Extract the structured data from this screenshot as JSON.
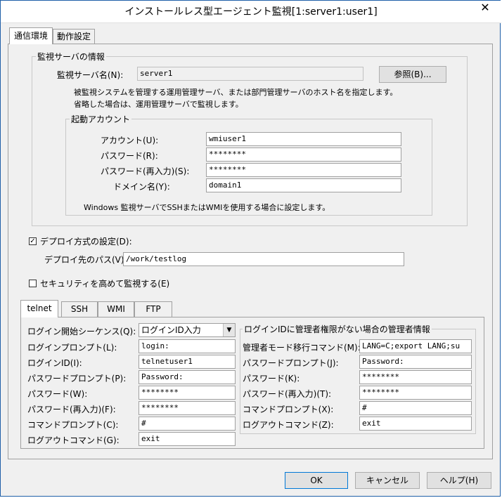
{
  "window": {
    "title": "インストールレス型エージェント監視[1:server1:user1]",
    "close_glyph": "✕"
  },
  "tabs": [
    "通信環境",
    "動作設定"
  ],
  "monitor_server": {
    "group_label": "監視サーバの情報",
    "name_label": "監視サーバ名(N):",
    "name_value": "server1",
    "browse_label": "参照(B)...",
    "desc1": "被監視システムを管理する運用管理サーバ、または部門管理サーバのホスト名を指定します。",
    "desc2": "省略した場合は、運用管理サーバで監視します。"
  },
  "startup_account": {
    "group_label": "起動アカウント",
    "account_label": "アカウント(U):",
    "account_value": "wmiuser1",
    "password_label": "パスワード(R):",
    "password_value": "********",
    "password2_label": "パスワード(再入力)(S):",
    "password2_value": "********",
    "domain_label": "ドメイン名(Y):",
    "domain_value": "domain1",
    "note": "Windows 監視サーバでSSHまたはWMIを使用する場合に設定します。"
  },
  "deploy": {
    "checked_glyph": "✓",
    "label": "デプロイ方式の設定(D):",
    "path_label": "デプロイ先のパス(V):",
    "path_value": "/work/testlog"
  },
  "security": {
    "label": "セキュリティを高めて監視する(E)"
  },
  "proto_tabs": [
    "telnet",
    "SSH",
    "WMI",
    "FTP"
  ],
  "telnet": {
    "seq_label": "ログイン開始シーケンス(Q):",
    "seq_value": "ログインID入力",
    "arrow_glyph": "▼",
    "login_prompt_label": "ログインプロンプト(L):",
    "login_prompt_value": "login:",
    "login_id_label": "ログインID(I):",
    "login_id_value": "telnetuser1",
    "pw_prompt_label": "パスワードプロンプト(P):",
    "pw_prompt_value": "Password:",
    "pw_label": "パスワード(W):",
    "pw_value": "********",
    "pw2_label": "パスワード(再入力)(F):",
    "pw2_value": "********",
    "cmd_prompt_label": "コマンドプロンプト(C):",
    "cmd_prompt_value": "#",
    "logout_label": "ログアウトコマンド(G):",
    "logout_value": "exit"
  },
  "admin": {
    "group_label": "ログインIDに管理者権限がない場合の管理者情報",
    "mode_cmd_label": "管理者モード移行コマンド(M):",
    "mode_cmd_value": "LANG=C;export LANG;su",
    "pw_prompt_label": "パスワードプロンプト(J):",
    "pw_prompt_value": "Password:",
    "pw_label": "パスワード(K):",
    "pw_value": "********",
    "pw2_label": "パスワード(再入力)(T):",
    "pw2_value": "********",
    "cmd_prompt_label": "コマンドプロンプト(X):",
    "cmd_prompt_value": "#",
    "logout_label": "ログアウトコマンド(Z):",
    "logout_value": "exit"
  },
  "buttons": {
    "ok": "OK",
    "cancel": "キャンセル",
    "help": "ヘルプ(H)"
  }
}
